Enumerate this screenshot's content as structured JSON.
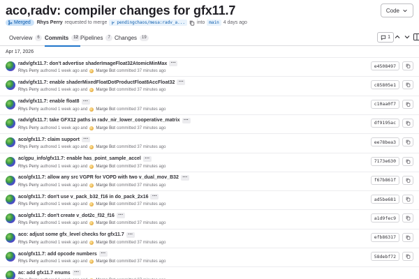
{
  "header": {
    "title": "aco,radv: compiler changes for gfx11.7",
    "code_button": "Code"
  },
  "mr_meta": {
    "status": "Merged",
    "author": "Rhys Perry",
    "requested_text": "requested to merge",
    "source_branch": "pendingchaos/mesa:radv_a...",
    "into_text": "into",
    "target_branch": "main",
    "time": "4 days ago"
  },
  "tabs": [
    {
      "label": "Overview",
      "count": "6"
    },
    {
      "label": "Commits",
      "count": "12"
    },
    {
      "label": "Pipelines",
      "count": "7"
    },
    {
      "label": "Changes",
      "count": "19"
    }
  ],
  "thread_count": "1",
  "date_header": "Apr 17, 2026",
  "commits": [
    {
      "title": "radv/gfx11.7: don't advertise shaderImageFloat32AtomicMinMax",
      "sha": "e4508497"
    },
    {
      "title": "radv/gfx11.7: enable shaderMixedFloatDotProductFloat8AccFloat32",
      "sha": "c85805e1"
    },
    {
      "title": "radv/gfx11.7: enable float8",
      "sha": "c10aa0f7"
    },
    {
      "title": "radv/gfx11.7: take GFX12 paths in radv_nir_lower_cooperative_matrix",
      "sha": "df9195ac"
    },
    {
      "title": "aco/gfx11.7: claim support",
      "sha": "ee78bea3"
    },
    {
      "title": "ac/gpu_info/gfx11.7: enable has_point_sample_accel",
      "sha": "7173e630"
    },
    {
      "title": "aco/gfx11.7: allow any src VGPR for VOPD with two v_dual_mov_B32",
      "sha": "f67b861f"
    },
    {
      "title": "aco/gfx11.7: don't use v_pack_b32_f16 in do_pack_2x16",
      "sha": "ad5be681"
    },
    {
      "title": "aco/gfx11.7: don't create v_dot2c_f32_f16",
      "sha": "a1d9fec9"
    },
    {
      "title": "aco: adjust some gfx_level checks for gfx11.7",
      "sha": "efb86317"
    },
    {
      "title": "aco/gfx11.7: add opcode numbers",
      "sha": "58debf72"
    },
    {
      "title": "ac: add gfx11.7 enums",
      "sha": ""
    }
  ],
  "commit_meta": {
    "author": "Rhys Perry",
    "authored": "authored 1 week ago and",
    "committer": "Marge Bot",
    "committed": "committed 37 minutes ago"
  },
  "icons": {
    "code_chevron": "chevron-down-icon",
    "merged": "merge-icon",
    "copy": "copy-icon",
    "thread": "comment-icon",
    "up": "chevron-up-icon",
    "down": "chevron-down-icon",
    "sidebar": "sidebar-toggle-icon"
  },
  "colors": {
    "accent": "#1f75cb",
    "merged_bg": "#cbe2f9",
    "merged_fg": "#0b5cad"
  }
}
